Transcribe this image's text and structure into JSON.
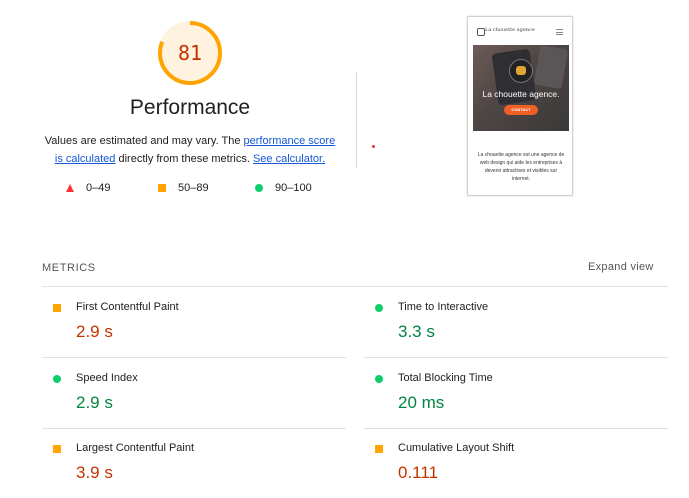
{
  "gauge": {
    "score": "81",
    "fraction": 0.81,
    "color": "#ffa400",
    "track_color": "#fff3e0",
    "text_color": "#c33300"
  },
  "performance": {
    "title": "Performance",
    "desc_part1": "Values are estimated and may vary. The ",
    "link_score": "performance score is calculated",
    "desc_part2": " directly from these metrics. ",
    "link_calc": "See calculator."
  },
  "legend": [
    {
      "shape": "triangle",
      "range": "0–49",
      "color": "#ff3333"
    },
    {
      "shape": "square",
      "range": "50–89",
      "color": "#ffa400"
    },
    {
      "shape": "circle",
      "range": "90–100",
      "color": "#0cce6b"
    }
  ],
  "screenshot": {
    "brand": "La chouette agence",
    "hero_text": "La chouette agence.",
    "button": "CONTACT",
    "body_text": "La chouette agence est une agence de web design qui aide les entreprises à devenir attractives et visibles sur internet."
  },
  "metrics": {
    "label": "METRICS",
    "expand": "Expand view",
    "items": [
      {
        "name": "First Contentful Paint",
        "value": "2.9 s",
        "status": "average"
      },
      {
        "name": "Time to Interactive",
        "value": "3.3 s",
        "status": "pass"
      },
      {
        "name": "Speed Index",
        "value": "2.9 s",
        "status": "pass"
      },
      {
        "name": "Total Blocking Time",
        "value": "20 ms",
        "status": "pass"
      },
      {
        "name": "Largest Contentful Paint",
        "value": "3.9 s",
        "status": "average"
      },
      {
        "name": "Cumulative Layout Shift",
        "value": "0.111",
        "status": "average"
      }
    ]
  }
}
